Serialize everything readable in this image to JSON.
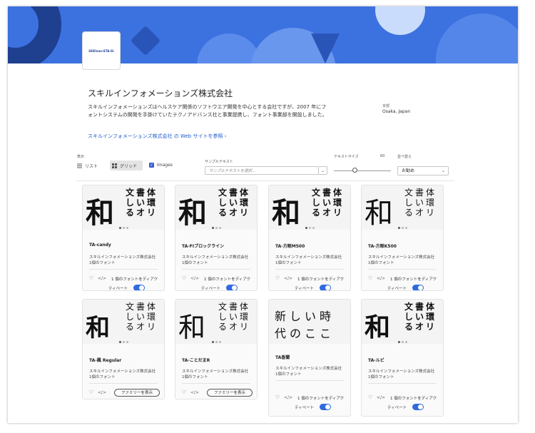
{
  "company": {
    "logo_text": "SEKIsan:STA:Si",
    "name": "スキルインフォメーションズ株式会社",
    "description": "スキルインフォメーションズはヘルスケア関係のソフトウエア開発を中心とする会社ですが、2007 年にフォントシステムの開発を手掛けていたテクノアドバンス社と事業提携し、フォント事業部を開設しました。",
    "link": "スキルインフォメーションズ株式会社 の Web サイトを参照 ›",
    "location_label": "本部",
    "location": "Osaka, Japan"
  },
  "controls": {
    "view_label": "表示",
    "list_label": "リスト",
    "grid_label": "グリッド",
    "images_label": "Images",
    "sample_label": "サンプルテキスト",
    "sample_placeholder": "サンプルテキストを選択...",
    "size_label": "テキストサイズ",
    "size_value": "60",
    "size_level": 0.35,
    "sort_label": "並べ替え",
    "sort_value": "お勧め"
  },
  "cards": [
    {
      "name": "TA-candy",
      "foundry": "スキルインフォメーションズ株式会社",
      "count": "1個のフォント",
      "action": "1 個のフォントをディアク",
      "action2": "ティベート",
      "active": true,
      "glyphs": {
        "big": "和",
        "c1": "文しる",
        "c2": "書いオ",
        "c3": "体環リ"
      }
    },
    {
      "name": "TA-FIブロックライン",
      "foundry": "スキルインフォメーションズ株式会社",
      "count": "1個のフォント",
      "action": "1 個のフォントをディアク",
      "action2": "ティベート",
      "active": true,
      "glyphs": {
        "big": "和",
        "c1": "文しる",
        "c2": "書いオ",
        "c3": "体環リ"
      }
    },
    {
      "name": "TA-方眼M500",
      "foundry": "スキルインフォメーションズ株式会社",
      "count": "1個のフォント",
      "action": "1 個のフォントをディアク",
      "action2": "ティベート",
      "active": true,
      "glyphs": {
        "big": "和",
        "c1": "文しる",
        "c2": "書いオ",
        "c3": "体環リ"
      }
    },
    {
      "name": "TA-方眼K500",
      "foundry": "スキルインフォメーションズ株式会社",
      "count": "1個のフォント",
      "action": "1 個のフォントをディアク",
      "action2": "ティベート",
      "active": true,
      "glyphs": {
        "big": "和",
        "c1": "文しる",
        "c2": "書いオ",
        "c3": "体環リ"
      }
    },
    {
      "name": "TA-楓 Regular",
      "foundry": "スキルインフォメーションズ株式会社",
      "count": "1個のフォント",
      "button": "ファミリーを表示",
      "glyphs": {
        "big": "和",
        "c1": "文しる",
        "c2": "書いオ",
        "c3": "体環リ"
      }
    },
    {
      "name": "TA-ことだまR",
      "foundry": "スキルインフォメーションズ株式会社",
      "count": "1個のフォント",
      "button": "ファミリーを表示",
      "glyphs": {
        "big": "和",
        "c1": "文しる",
        "c2": "書いオ",
        "c3": "体環リ"
      }
    },
    {
      "name": "TA香蘭",
      "foundry": "スキルインフォメーションズ株式会社",
      "count": "1個のフォント",
      "action": "1 個のフォントをディアク",
      "action2": "ティベート",
      "active": true,
      "glyphs": {
        "l1": "新しい時",
        "l2": "代のここ"
      }
    },
    {
      "name": "TA-ルビ",
      "foundry": "スキルインフォメーションズ株式会社",
      "count": "1個のフォント",
      "action": "1 個のフォントをディアク",
      "action2": "ティベート",
      "active": true,
      "glyphs": {
        "big": "和",
        "c1": "文しる",
        "c2": "書いオ",
        "c3": "体環リ"
      }
    }
  ],
  "colors": {
    "banner": "#3c71e0",
    "accent": "#2f6ae0",
    "link": "#1f5ccc"
  },
  "icons": [
    "heart-icon",
    "code-icon",
    "list-icon",
    "grid-icon",
    "chevron-down-icon",
    "check-icon"
  ]
}
